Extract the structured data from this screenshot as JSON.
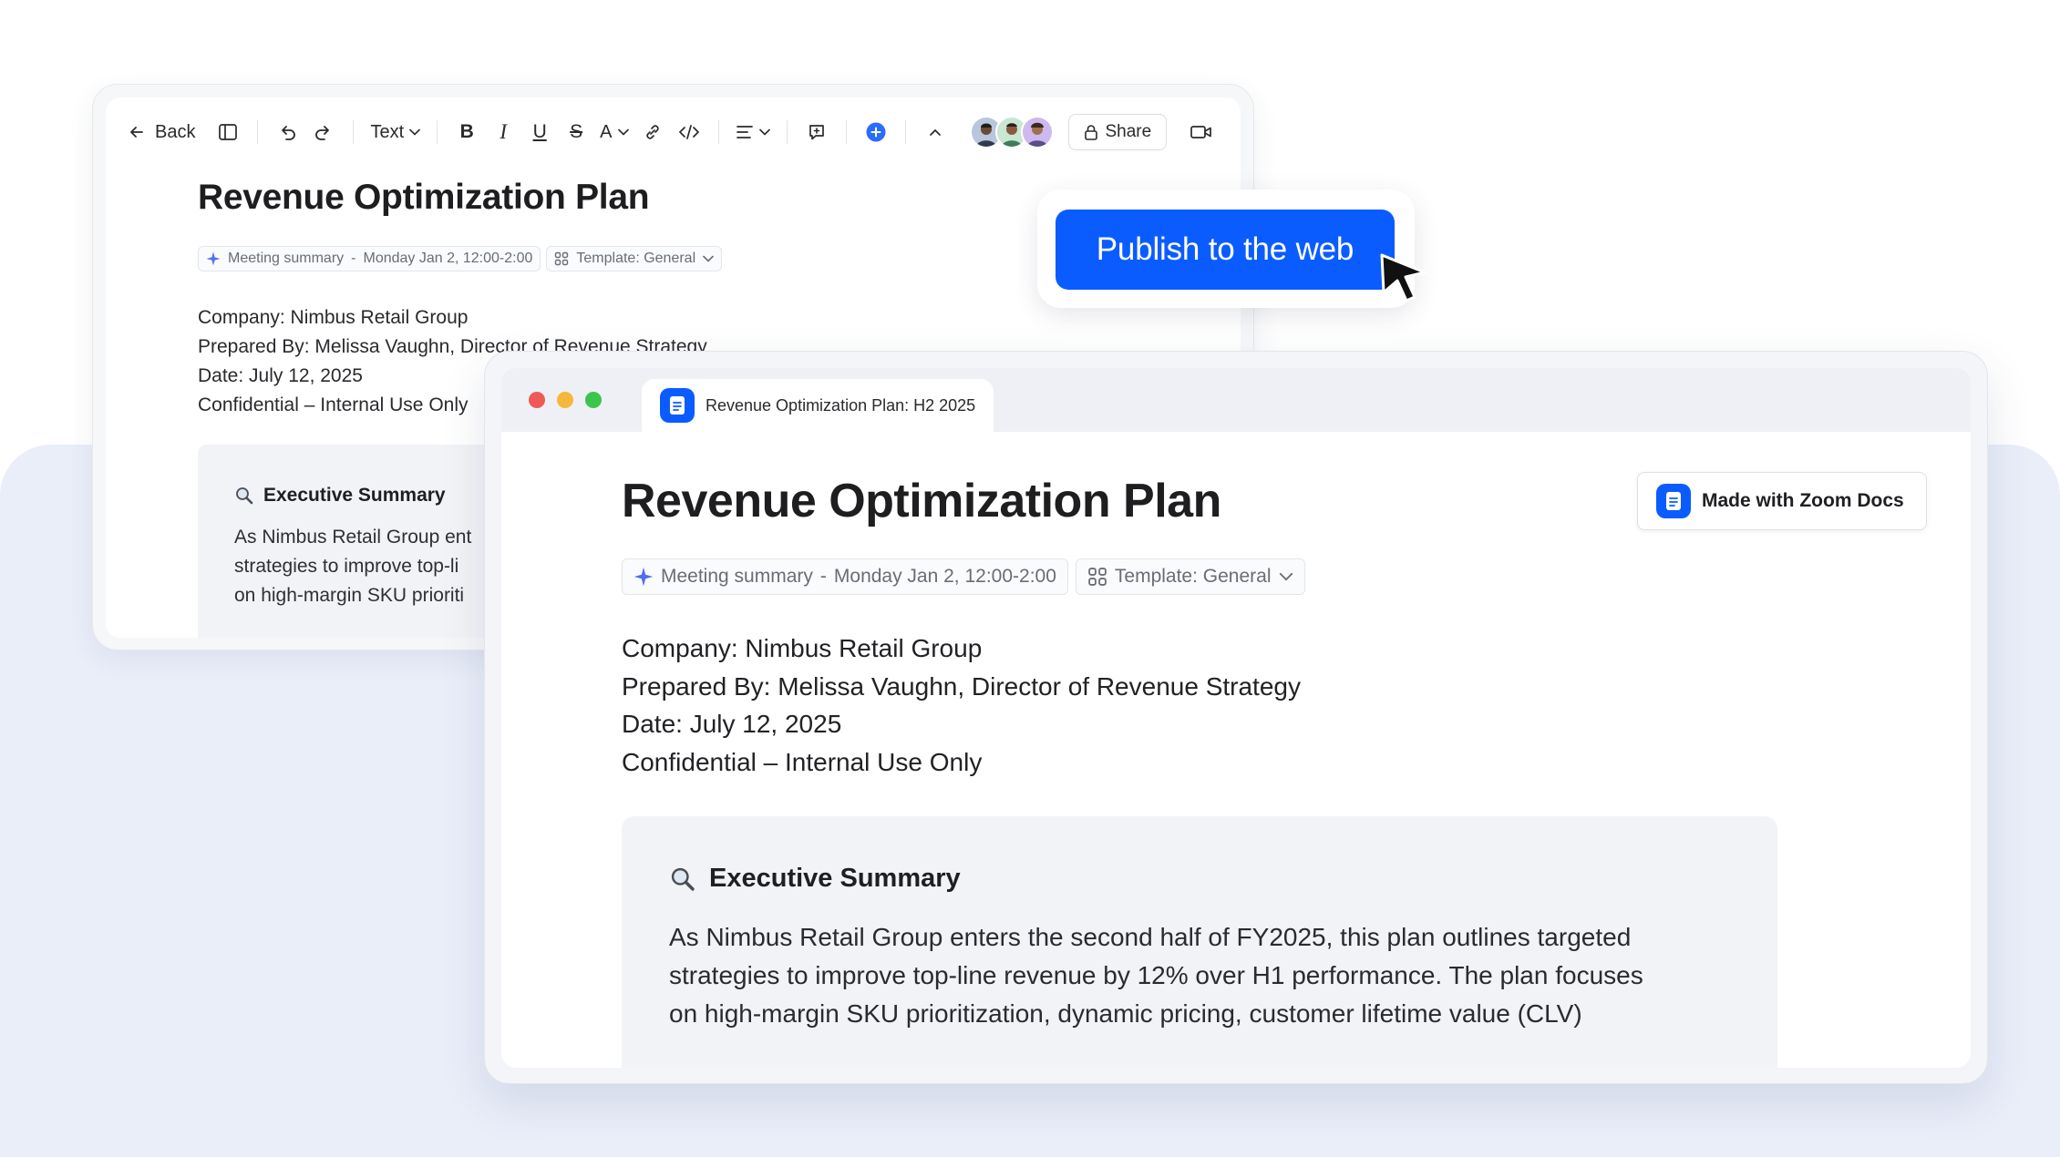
{
  "editor": {
    "toolbar": {
      "back_label": "Back",
      "text_style_label": "Text",
      "bold": "B",
      "italic": "I",
      "underline": "U",
      "strike": "S",
      "font_color": "A",
      "share_label": "Share"
    },
    "title": "Revenue Optimization Plan",
    "chips": {
      "meeting_label": "Meeting summary",
      "meeting_sep": "-",
      "meeting_time": "Monday Jan 2, 12:00-2:00",
      "template_label": "Template: General"
    },
    "meta": [
      "Company: Nimbus Retail Group",
      "Prepared By: Melissa Vaughn, Director of Revenue Strategy",
      "Date: July 12, 2025",
      "Confidential – Internal Use Only"
    ],
    "summary": {
      "heading": "Executive Summary",
      "lines": [
        "As Nimbus Retail Group ent",
        "strategies to improve top-li",
        "on high-margin SKU prioriti"
      ]
    }
  },
  "publish": {
    "label": "Publish to the web",
    "color": "#0b5cff"
  },
  "browser": {
    "tab_title": "Revenue Optimization Plan: H2 2025",
    "traffic_lights": [
      "#ee5b57",
      "#f5b83c",
      "#3dc44f"
    ],
    "badge_label": "Made with Zoom Docs",
    "title": "Revenue Optimization Plan",
    "chips": {
      "meeting_label": "Meeting summary",
      "meeting_sep": "-",
      "meeting_time": "Monday Jan 2, 12:00-2:00",
      "template_label": "Template: General"
    },
    "meta": [
      "Company: Nimbus Retail Group",
      "Prepared By: Melissa Vaughn, Director of Revenue Strategy",
      "Date: July 12, 2025",
      "Confidential – Internal Use Only"
    ],
    "summary": {
      "heading": "Executive Summary",
      "lines": [
        "As Nimbus Retail Group enters the second half of FY2025, this plan outlines targeted",
        "strategies to improve top-line revenue by 12% over H1 performance. The plan focuses",
        "on high-margin SKU prioritization, dynamic pricing, customer lifetime value (CLV)"
      ]
    }
  },
  "icons": {
    "back": "arrow-left-icon",
    "sidebar": "sidebar-toggle-icon",
    "undo": "undo-icon",
    "redo": "redo-icon",
    "link": "link-icon",
    "code": "code-icon",
    "align": "align-left-icon",
    "comment": "comment-icon",
    "add": "plus-circle-icon",
    "collapse": "chevron-up-icon",
    "lock": "lock-icon",
    "video": "video-camera-icon",
    "sparkle": "sparkle-icon",
    "template": "template-grid-icon",
    "magnifier": "magnifier-icon",
    "doc": "zoom-docs-icon",
    "cursor": "cursor-arrow-icon"
  }
}
